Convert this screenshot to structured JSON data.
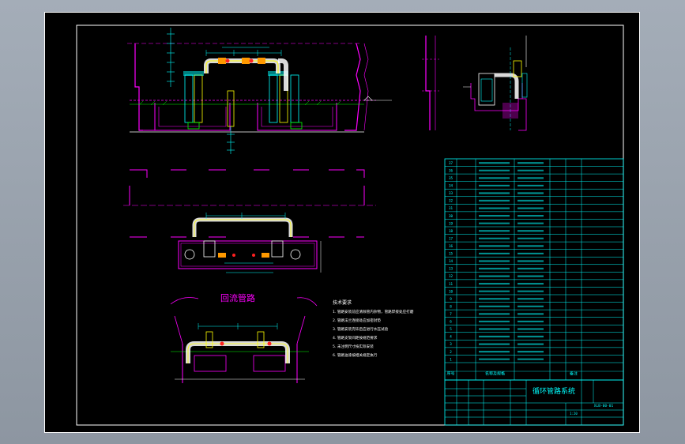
{
  "viewport": {
    "background": "#9aa3ae"
  },
  "sheet": {
    "background": "#000000",
    "frame_color": "#ffffff"
  },
  "palette": {
    "magenta": "#ff00ff",
    "cyan": "#00ffff",
    "yellow": "#ffff00",
    "green": "#00ff00",
    "red": "#ff2020",
    "white": "#ffffff",
    "orange": "#ff9900",
    "blue": "#4080ff"
  },
  "views": {
    "reflux_title": "回流管路"
  },
  "notes": {
    "title": "技术要求",
    "lines": [
      "1. 管路安装前应清除管内杂物，管路焊接处应打磨",
      "2. 管路法兰连接处应加密封垫",
      "3. 管路安装完毕后应进行水压试验",
      "4. 管路支架间距按规范要求",
      "5. 未注明尺寸按实际安装",
      "6. 管路油漆按相关规定执行"
    ]
  },
  "bom": {
    "rows": [
      [
        "37",
        "",
        "",
        "1",
        "",
        ""
      ],
      [
        "36",
        "",
        "",
        "",
        "",
        ""
      ],
      [
        "35",
        "",
        "",
        "",
        "",
        ""
      ],
      [
        "34",
        "",
        "",
        "",
        "",
        ""
      ],
      [
        "33",
        "",
        "",
        "",
        "",
        ""
      ],
      [
        "32",
        "",
        "",
        "",
        "",
        ""
      ],
      [
        "31",
        "",
        "",
        "",
        "",
        ""
      ],
      [
        "30",
        "",
        "",
        "",
        "",
        ""
      ],
      [
        "19",
        "",
        "",
        "",
        "",
        ""
      ],
      [
        "18",
        "",
        "",
        "",
        "",
        ""
      ],
      [
        "17",
        "",
        "",
        "",
        "",
        ""
      ],
      [
        "16",
        "",
        "",
        "",
        "",
        ""
      ],
      [
        "15",
        "",
        "",
        "",
        "",
        ""
      ],
      [
        "14",
        "",
        "",
        "",
        "",
        ""
      ],
      [
        "13",
        "",
        "",
        "",
        "",
        ""
      ],
      [
        "12",
        "",
        "",
        "",
        "",
        ""
      ],
      [
        "11",
        "",
        "",
        "",
        "",
        ""
      ],
      [
        "10",
        "",
        "",
        "",
        "",
        ""
      ],
      [
        "9",
        "",
        "",
        "",
        "",
        ""
      ],
      [
        "8",
        "",
        "",
        "",
        "",
        ""
      ],
      [
        "7",
        "",
        "",
        "",
        "",
        ""
      ],
      [
        "6",
        "",
        "",
        "",
        "",
        ""
      ],
      [
        "5",
        "",
        "",
        "",
        "",
        ""
      ],
      [
        "4",
        "",
        "",
        "",
        "",
        ""
      ],
      [
        "3",
        "",
        "",
        "",
        "",
        ""
      ],
      [
        "2",
        "",
        "",
        "",
        "",
        ""
      ],
      [
        "1",
        "",
        "",
        "",
        "",
        ""
      ]
    ],
    "header": [
      "序号",
      "",
      "名称及规格",
      "",
      "",
      "备注"
    ]
  },
  "title_block": {
    "drawing_name": "循环管路系统",
    "drawing_no": "XLB-00-01",
    "scale": "1:20"
  }
}
